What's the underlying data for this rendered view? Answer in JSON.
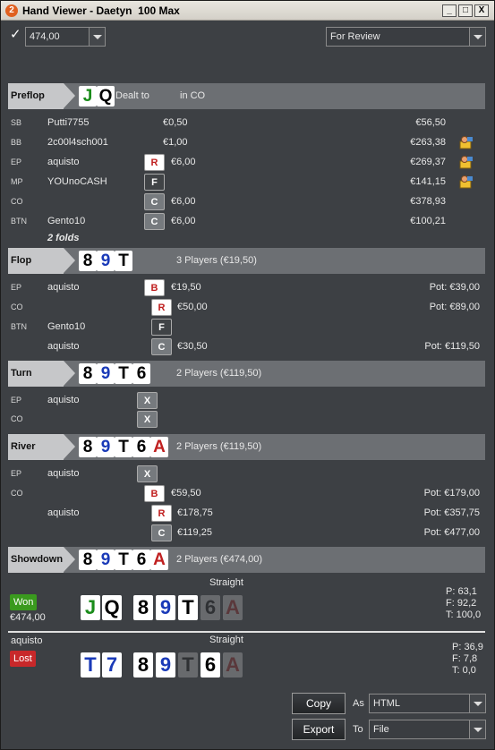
{
  "window": {
    "title": "Hand Viewer - Daetyn  100 Max",
    "app_icon": "2",
    "buttons": [
      "_",
      "□",
      "X"
    ]
  },
  "toolbar": {
    "stake_value": "474,00",
    "filter_value": "For Review"
  },
  "preflop": {
    "name": "Preflop",
    "hero_cards": [
      {
        "r": "J",
        "c": "#1a8c1a"
      },
      {
        "r": "Q",
        "c": "#000000"
      }
    ],
    "dealt_to": "Dealt to",
    "position": "in CO",
    "rows": [
      {
        "pos": "SB",
        "player": "Putti7755",
        "action": "",
        "amount": "€0,50",
        "stack": "€56,50",
        "hud": false
      },
      {
        "pos": "BB",
        "player": "2c00l4sch001",
        "action": "",
        "amount": "€1,00",
        "stack": "€263,38",
        "hud": true
      },
      {
        "pos": "EP",
        "player": "aquisto",
        "action": "R",
        "amount": "€6,00",
        "stack": "€269,37",
        "hud": true
      },
      {
        "pos": "MP",
        "player": "YOUnoCASH",
        "action": "F",
        "amount": "",
        "stack": "€141,15",
        "hud": true
      },
      {
        "pos": "CO",
        "player": "",
        "action": "C",
        "amount": "€6,00",
        "stack": "€378,93",
        "hud": false
      },
      {
        "pos": "BTN",
        "player": "Gento10",
        "action": "C",
        "amount": "€6,00",
        "stack": "€100,21",
        "hud": false
      }
    ],
    "folds": "2 folds"
  },
  "flop": {
    "name": "Flop",
    "cards": [
      {
        "r": "8",
        "c": "#000000"
      },
      {
        "r": "9",
        "c": "#1a3ab8"
      },
      {
        "r": "T",
        "c": "#000000"
      }
    ],
    "info": "3 Players (€19,50)",
    "rows": [
      {
        "pos": "EP",
        "player": "aquisto",
        "action": "B",
        "amount": "€19,50",
        "pot": "Pot: €39,00"
      },
      {
        "pos": "CO",
        "player": "",
        "action": "R",
        "amount": "€50,00",
        "pot": "Pot: €89,00"
      },
      {
        "pos": "BTN",
        "player": "Gento10",
        "action": "F",
        "amount": "",
        "pot": ""
      },
      {
        "pos": "",
        "player": "aquisto",
        "action": "C",
        "amount": "€30,50",
        "pot": "Pot: €119,50"
      }
    ]
  },
  "turn": {
    "name": "Turn",
    "cards": [
      {
        "r": "8",
        "c": "#000000"
      },
      {
        "r": "9",
        "c": "#1a3ab8"
      },
      {
        "r": "T",
        "c": "#000000"
      },
      {
        "r": "6",
        "c": "#000000"
      }
    ],
    "info": "2 Players (€119,50)",
    "rows": [
      {
        "pos": "EP",
        "player": "aquisto",
        "action": "X",
        "amount": "",
        "pot": ""
      },
      {
        "pos": "CO",
        "player": "",
        "action": "X",
        "amount": "",
        "pot": ""
      }
    ]
  },
  "river": {
    "name": "River",
    "cards": [
      {
        "r": "8",
        "c": "#000000"
      },
      {
        "r": "9",
        "c": "#1a3ab8"
      },
      {
        "r": "T",
        "c": "#000000"
      },
      {
        "r": "6",
        "c": "#000000"
      },
      {
        "r": "A",
        "c": "#c02020"
      }
    ],
    "info": "2 Players (€119,50)",
    "rows": [
      {
        "pos": "EP",
        "player": "aquisto",
        "action": "X",
        "amount": "",
        "pot": ""
      },
      {
        "pos": "CO",
        "player": "",
        "action": "B",
        "amount": "€59,50",
        "pot": "Pot: €179,00"
      },
      {
        "pos": "",
        "player": "aquisto",
        "action": "R",
        "amount": "€178,75",
        "pot": "Pot: €357,75"
      },
      {
        "pos": "",
        "player": "",
        "action": "C",
        "amount": "€119,25",
        "pot": "Pot: €477,00"
      }
    ]
  },
  "showdown": {
    "name": "Showdown",
    "cards": [
      {
        "r": "8",
        "c": "#000000"
      },
      {
        "r": "9",
        "c": "#1a3ab8"
      },
      {
        "r": "T",
        "c": "#000000"
      },
      {
        "r": "6",
        "c": "#000000"
      },
      {
        "r": "A",
        "c": "#c02020"
      }
    ],
    "info": "2 Players (€474,00)",
    "hero": {
      "hand_name": "Straight",
      "result": "Won",
      "amount": "€474,00",
      "hole": [
        {
          "r": "J",
          "c": "#1a8c1a"
        },
        {
          "r": "Q",
          "c": "#000000"
        }
      ],
      "board": [
        {
          "r": "8",
          "c": "#000000"
        },
        {
          "r": "9",
          "c": "#1a3ab8"
        },
        {
          "r": "T",
          "c": "#000000"
        },
        {
          "r": "6",
          "c": "#000000"
        },
        {
          "r": "A",
          "c": "#c02020"
        }
      ],
      "board_faded": [
        false,
        false,
        false,
        true,
        true
      ],
      "stats": [
        "P: 63,1",
        "F: 92,2",
        "T: 100,0"
      ]
    },
    "villain": {
      "player": "aquisto",
      "hand_name": "Straight",
      "result": "Lost",
      "hole": [
        {
          "r": "T",
          "c": "#1a3ab8"
        },
        {
          "r": "7",
          "c": "#1a3ab8"
        }
      ],
      "board": [
        {
          "r": "8",
          "c": "#000000"
        },
        {
          "r": "9",
          "c": "#1a3ab8"
        },
        {
          "r": "T",
          "c": "#000000"
        },
        {
          "r": "6",
          "c": "#000000"
        },
        {
          "r": "A",
          "c": "#c02020"
        }
      ],
      "board_faded": [
        false,
        false,
        true,
        false,
        true
      ],
      "stats": [
        "P: 36,9",
        "F: 7,8",
        "T: 0,0"
      ]
    }
  },
  "footer": {
    "copy_label": "Copy",
    "as_label": "As",
    "format_value": "HTML",
    "export_label": "Export",
    "to_label": "To",
    "dest_value": "File"
  },
  "colors": {
    "won": "#3a9a1e",
    "lost": "#c8282a",
    "bet_text": "#c02020"
  }
}
